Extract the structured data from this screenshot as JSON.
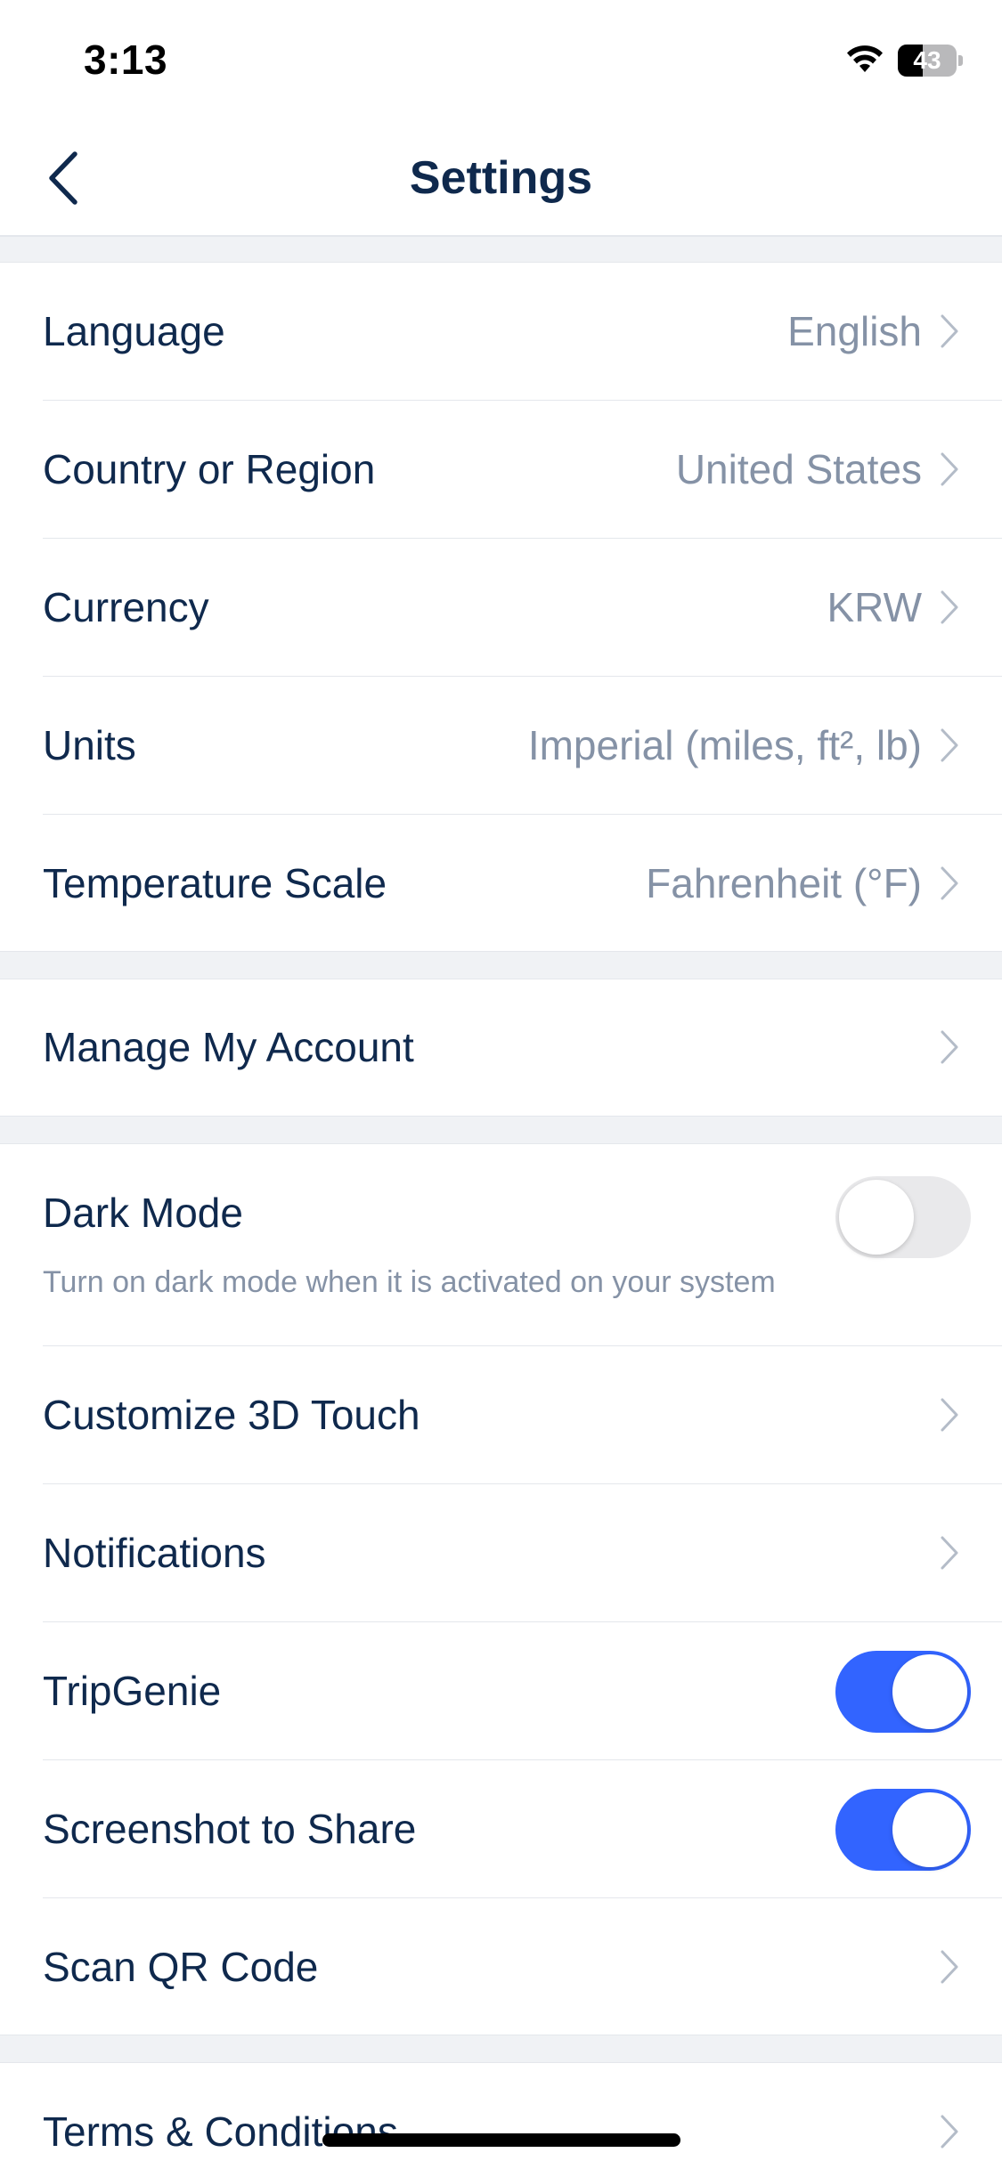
{
  "status_bar": {
    "time": "3:13",
    "battery_level": "43",
    "battery_fraction": 0.43
  },
  "nav": {
    "title": "Settings",
    "back_icon": "chevron-left-icon"
  },
  "regional": [
    {
      "label": "Language",
      "value": "English"
    },
    {
      "label": "Country or Region",
      "value": "United States"
    },
    {
      "label": "Currency",
      "value": "KRW"
    },
    {
      "label": "Units",
      "value": "Imperial (miles, ft², lb)"
    },
    {
      "label": "Temperature Scale",
      "value": "Fahrenheit (°F)"
    }
  ],
  "account": {
    "label": "Manage My Account"
  },
  "dark_mode": {
    "label": "Dark Mode",
    "description": "Turn on dark mode when it is activated on your system",
    "enabled": false
  },
  "features": {
    "customize_3d_touch": "Customize 3D Touch",
    "notifications": "Notifications",
    "tripgenie": {
      "label": "TripGenie",
      "enabled": true
    },
    "screenshot_to_share": {
      "label": "Screenshot to Share",
      "enabled": true
    },
    "scan_qr": "Scan QR Code"
  },
  "legal": {
    "terms": "Terms & Conditions"
  },
  "colors": {
    "accent": "#3264ff",
    "text_primary": "#0f294d",
    "text_secondary": "#8592a6",
    "separator_bg": "#f0f2f5"
  }
}
